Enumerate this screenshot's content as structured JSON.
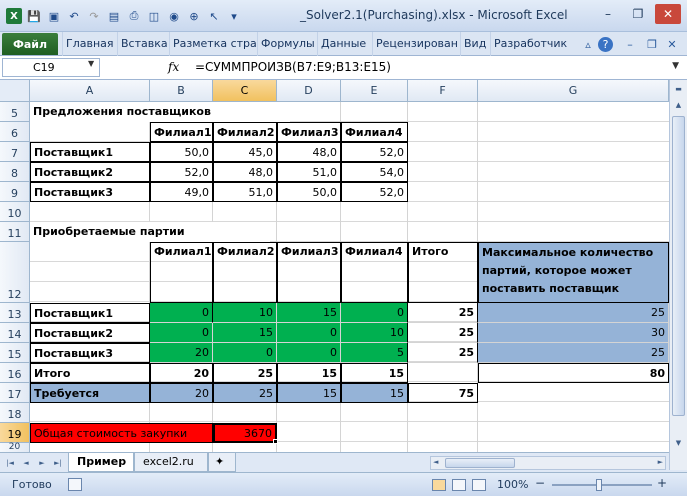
{
  "window": {
    "title": "_Solver2.1(Purchasing).xlsx  -  Microsoft Excel",
    "minimize": "–",
    "restore": "❐",
    "close": "✕"
  },
  "ribbon": {
    "file_tab": "Файл",
    "tabs": [
      "Главная",
      "Вставка",
      "Разметка стра",
      "Формулы",
      "Данные",
      "Рецензирован",
      "Вид",
      "Разработчик"
    ],
    "help": "?"
  },
  "formula_bar": {
    "name_box": "C19",
    "fx": "fx",
    "formula": "=СУММПРОИЗВ(B7:E9;B13:E15)"
  },
  "columns": [
    "A",
    "B",
    "C",
    "D",
    "E",
    "F",
    "G"
  ],
  "rows": [
    "5",
    "6",
    "7",
    "8",
    "9",
    "10",
    "11",
    "12",
    "13",
    "14",
    "15",
    "16",
    "17",
    "18",
    "19",
    "20"
  ],
  "cells": {
    "a5": "Предложения поставщиков",
    "h6": [
      "Филиал1",
      "Филиал2",
      "Филиал3",
      "Филиал4"
    ],
    "r7": {
      "label": "Поставщик1",
      "v": [
        "50,0",
        "45,0",
        "48,0",
        "52,0"
      ]
    },
    "r8": {
      "label": "Поставщик2",
      "v": [
        "52,0",
        "48,0",
        "51,0",
        "54,0"
      ]
    },
    "r9": {
      "label": "Поставщик3",
      "v": [
        "49,0",
        "51,0",
        "50,0",
        "52,0"
      ]
    },
    "a11": "Приобретаемые партии",
    "h12": [
      "Филиал1",
      "Филиал2",
      "Филиал3",
      "Филиал4",
      "Итого"
    ],
    "g12": [
      "Максимальное количество",
      "партий, которое может",
      "поставить поставщик"
    ],
    "r13": {
      "label": "Поставщик1",
      "v": [
        "0",
        "10",
        "15",
        "0"
      ],
      "total": "25",
      "max": "25"
    },
    "r14": {
      "label": "Поставщик2",
      "v": [
        "0",
        "15",
        "0",
        "10"
      ],
      "total": "25",
      "max": "30"
    },
    "r15": {
      "label": "Поставщик3",
      "v": [
        "20",
        "0",
        "0",
        "5"
      ],
      "total": "25",
      "max": "25"
    },
    "r16": {
      "label": "Итого",
      "v": [
        "20",
        "25",
        "15",
        "15"
      ],
      "g": "80"
    },
    "r17": {
      "label": "Требуется",
      "v": [
        "20",
        "25",
        "15",
        "15"
      ],
      "total": "75"
    },
    "a19": "Общая стоимость закупки",
    "c19": "3670"
  },
  "sheets": {
    "tabs": [
      "Пример",
      "excel2.ru"
    ],
    "nav": [
      "|◄",
      "◄",
      "►",
      "►|"
    ]
  },
  "status": {
    "ready": "Готово",
    "zoom": "100%",
    "minus": "−",
    "plus": "+"
  },
  "colors": {
    "green": "#00b050",
    "blue": "#95b3d7",
    "red": "#ff0000",
    "accent": "#1f5e22"
  }
}
